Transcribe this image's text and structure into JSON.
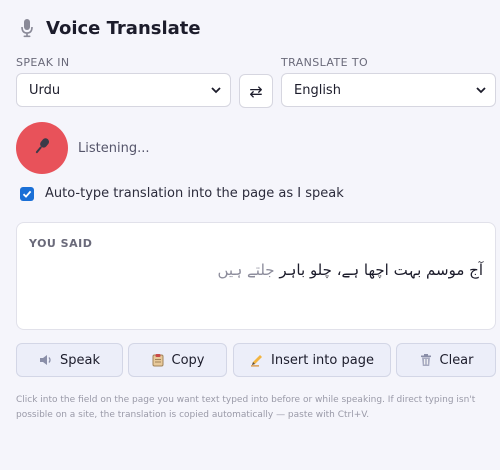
{
  "header": {
    "title": "Voice Translate",
    "icon": "microphone-icon"
  },
  "speak_in": {
    "label": "SPEAK IN",
    "selected": "Urdu"
  },
  "translate_to": {
    "label": "TRANSLATE TO",
    "selected": "English"
  },
  "swap": {
    "glyph": "⇄"
  },
  "mic": {
    "status": "Listening...",
    "color": "#e8525a"
  },
  "auto_type": {
    "label": "Auto-type translation into the page as I speak",
    "checked": true
  },
  "you_said": {
    "label": "YOU SAID",
    "final_text": "آج موسم بہت اچھا ہے، چلو باہر",
    "interim_text": "جلتے ہیں"
  },
  "buttons": {
    "speak": "Speak",
    "copy": "Copy",
    "insert": "Insert into page",
    "clear": "Clear"
  },
  "hint": "Click into the field on the page you want text typed into before or while speaking. If direct typing isn't possible on a site, the translation is copied automatically — paste with Ctrl+V.",
  "colors": {
    "accent": "#1a6fd6",
    "mic": "#e8525a",
    "button_bg": "#eceef9"
  }
}
